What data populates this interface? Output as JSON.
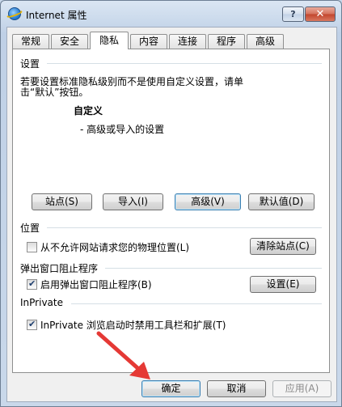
{
  "window": {
    "title": "Internet 属性",
    "help_label": "?",
    "close_label": "✕"
  },
  "tabs": [
    {
      "label": "常规",
      "active": false
    },
    {
      "label": "安全",
      "active": false
    },
    {
      "label": "隐私",
      "active": true
    },
    {
      "label": "内容",
      "active": false
    },
    {
      "label": "连接",
      "active": false
    },
    {
      "label": "程序",
      "active": false
    },
    {
      "label": "高级",
      "active": false
    }
  ],
  "settings": {
    "title": "设置",
    "description_line1": "若要设置标准隐私级别而不是使用自定义设置，请单",
    "description_line2": "击“默认”按钮。",
    "level_name": "自定义",
    "level_detail": "- 高级或导入的设置",
    "buttons": {
      "sites": "站点(S)",
      "import": "导入(I)",
      "advanced": "高级(V)",
      "default": "默认值(D)"
    }
  },
  "location": {
    "title": "位置",
    "checkbox_label": "从不允许网站请求您的物理位置(L)",
    "checked": false,
    "clear_button": "清除站点(C)"
  },
  "popup": {
    "title": "弹出窗口阻止程序",
    "checkbox_label": "启用弹出窗口阻止程序(B)",
    "checked": true,
    "settings_button": "设置(E)"
  },
  "inprivate": {
    "title": "InPrivate",
    "checkbox_label": "InPrivate 浏览启动时禁用工具栏和扩展(T)",
    "checked": true
  },
  "footer": {
    "ok": "确定",
    "cancel": "取消",
    "apply": "应用(A)"
  },
  "colors": {
    "pointer_arrow": "#e53935"
  }
}
